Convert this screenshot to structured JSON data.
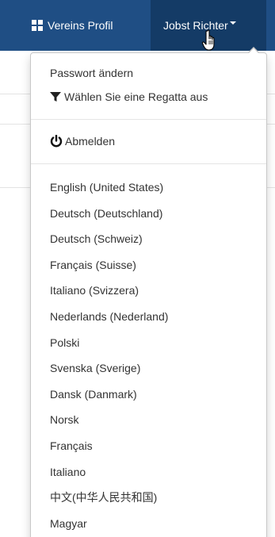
{
  "navbar": {
    "profile_label": "Vereins Profil",
    "user_label": "Jobst Richter"
  },
  "dropdown": {
    "account_items": [
      {
        "label": "Passwort ändern"
      },
      {
        "label": "Wählen Sie eine Regatta aus",
        "icon": "filter-icon"
      }
    ],
    "logout_label": "Abmelden",
    "languages": [
      "English (United States)",
      "Deutsch (Deutschland)",
      "Deutsch (Schweiz)",
      "Français (Suisse)",
      "Italiano (Svizzera)",
      "Nederlands (Nederland)",
      "Polski",
      "Svenska (Sverige)",
      "Dansk (Danmark)",
      "Norsk",
      "Français",
      "Italiano",
      "中文(中华人民共和国)",
      "Magyar"
    ]
  },
  "colors": {
    "navbar_bg": "#1f4e84",
    "navbar_active_bg": "#143b66",
    "menu_text": "#333333"
  }
}
